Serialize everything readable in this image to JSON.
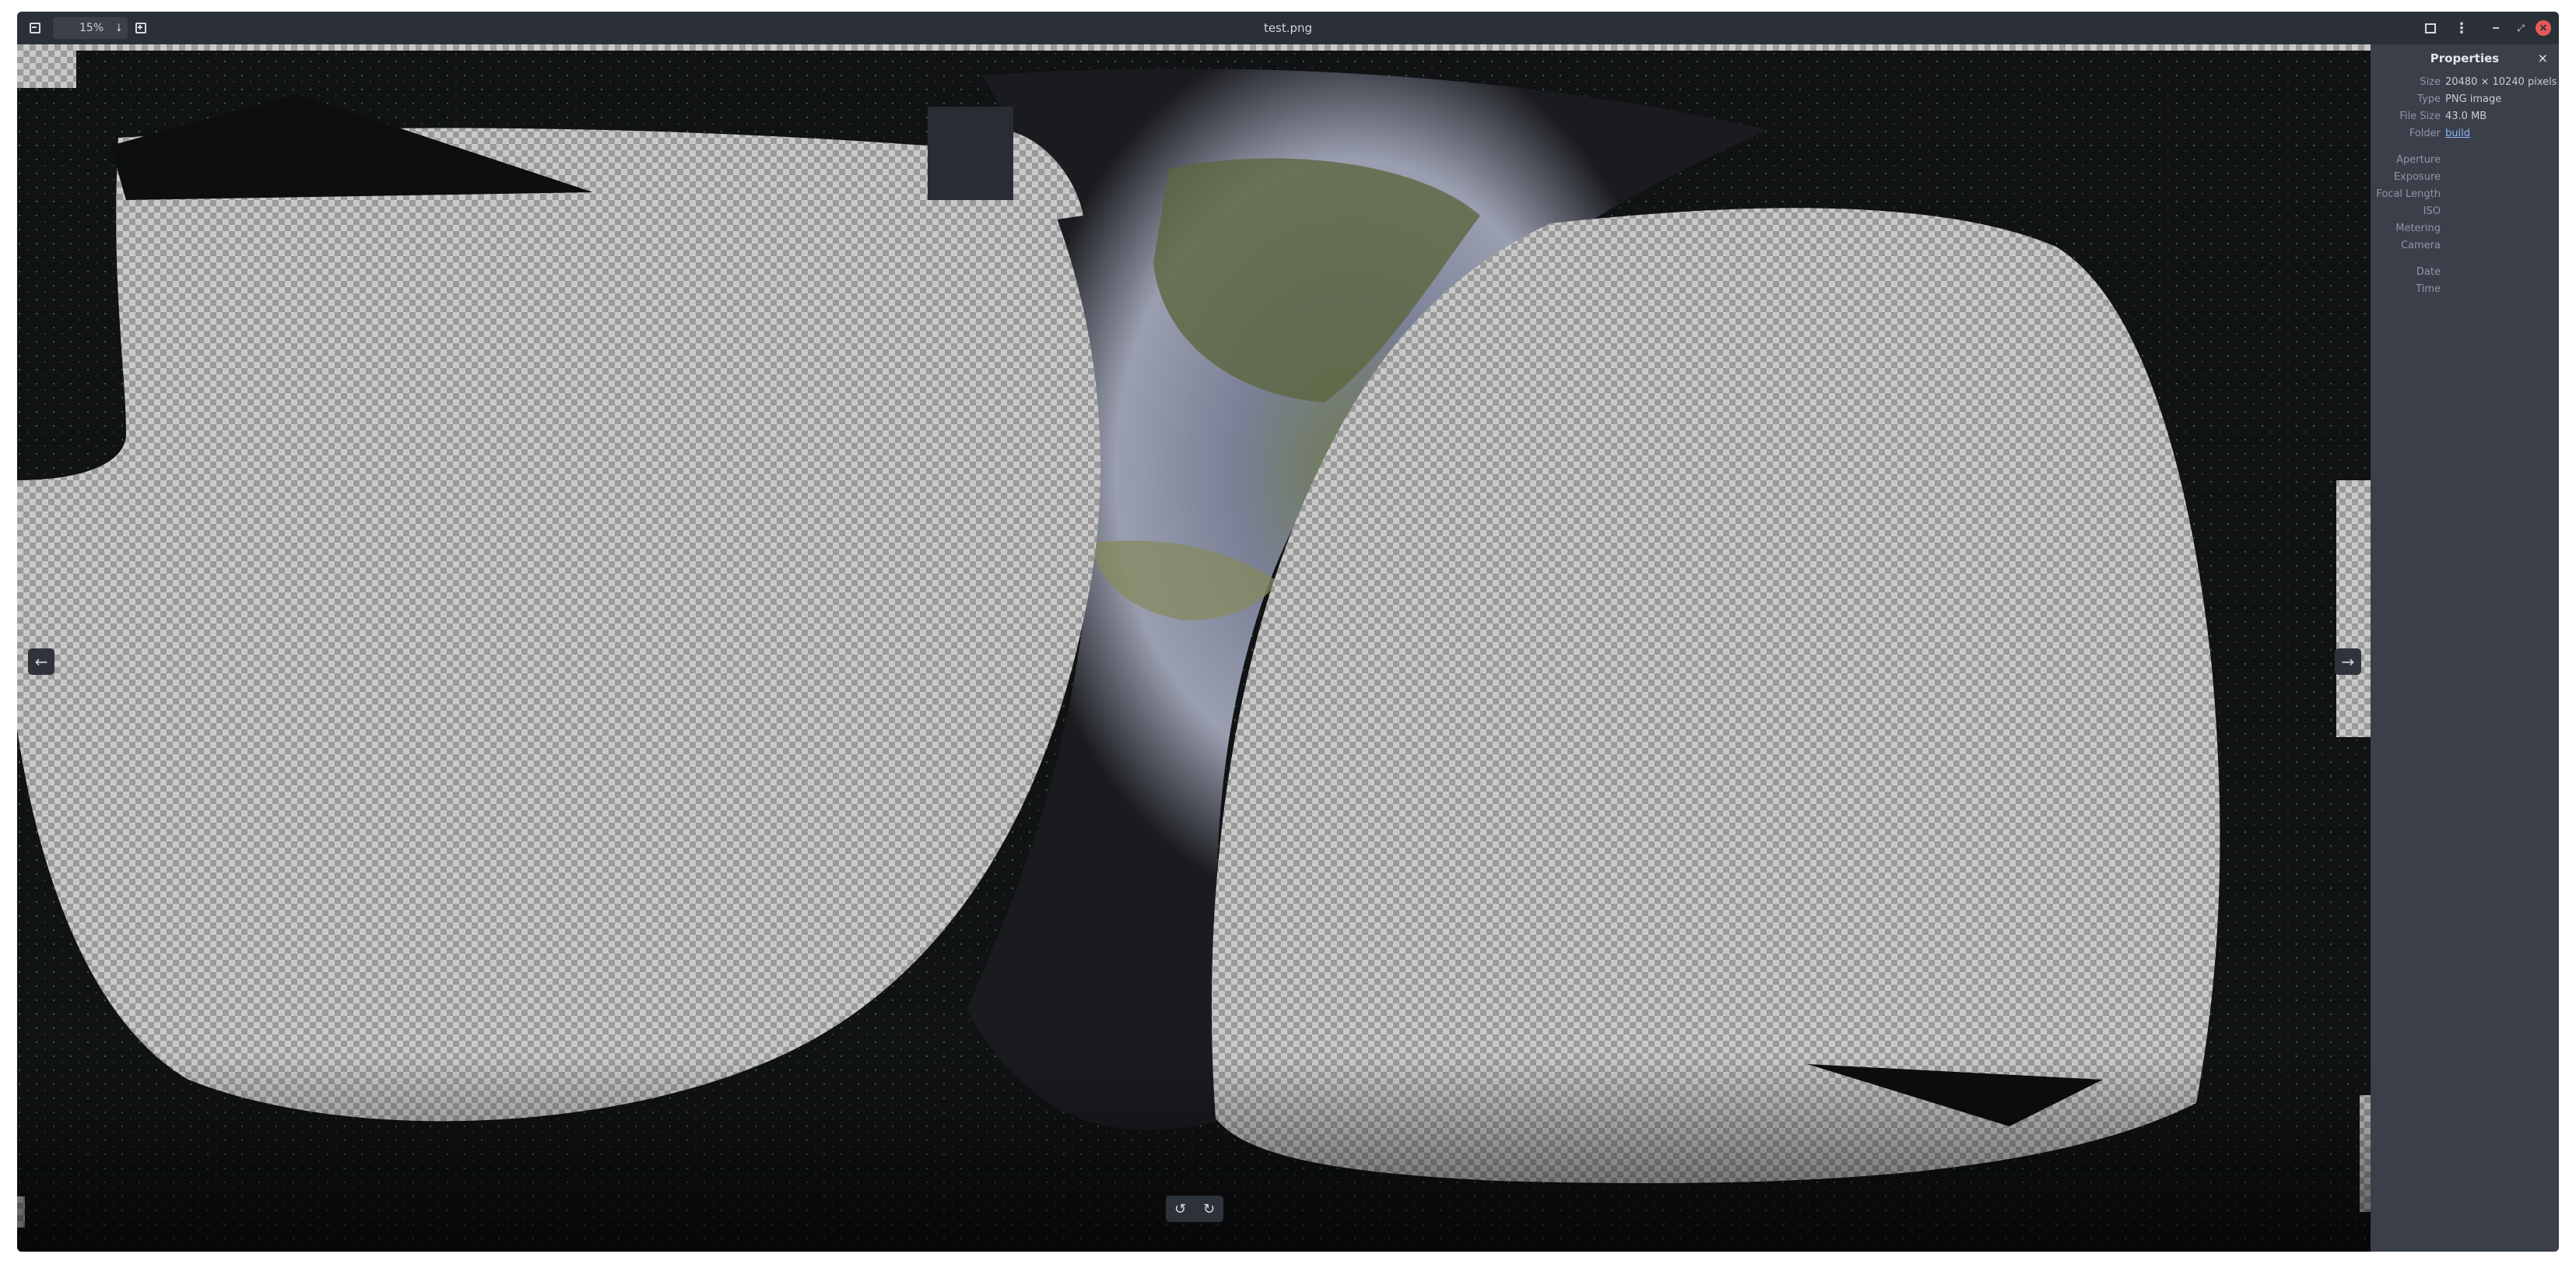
{
  "window": {
    "title": "test.png"
  },
  "toolbar": {
    "zoom_value": "15%"
  },
  "sidebar": {
    "title": "Properties",
    "rows": [
      {
        "key": "Size",
        "value": "20480 × 10240 pixels"
      },
      {
        "key": "Type",
        "value": "PNG image"
      },
      {
        "key": "File Size",
        "value": "43.0 MB"
      },
      {
        "key": "Folder",
        "value": "build"
      }
    ],
    "exif_keys": [
      "Aperture",
      "Exposure",
      "Focal Length",
      "ISO",
      "Metering",
      "Camera"
    ],
    "datetime_keys": [
      "Date",
      "Time"
    ]
  },
  "colors": {
    "window_bg": "#2b2f37",
    "sidebar_bg": "#3a3f4a",
    "link": "#8ab4f8",
    "close_button": "#e45a5a",
    "dotted_overlay": "#3fae3f"
  },
  "icons": {
    "zoom_out": "minus-icon",
    "zoom_dropdown": "arrow-down-icon",
    "zoom_in": "plus-icon",
    "fullscreen": "fullscreen-icon",
    "menu": "kebab-menu-icon",
    "minimize": "minimize-icon",
    "maximize": "maximize-icon",
    "close": "close-icon",
    "prev": "arrow-left-icon",
    "next": "arrow-right-icon",
    "rotate_left": "rotate-left-icon",
    "rotate_right": "rotate-right-icon"
  }
}
